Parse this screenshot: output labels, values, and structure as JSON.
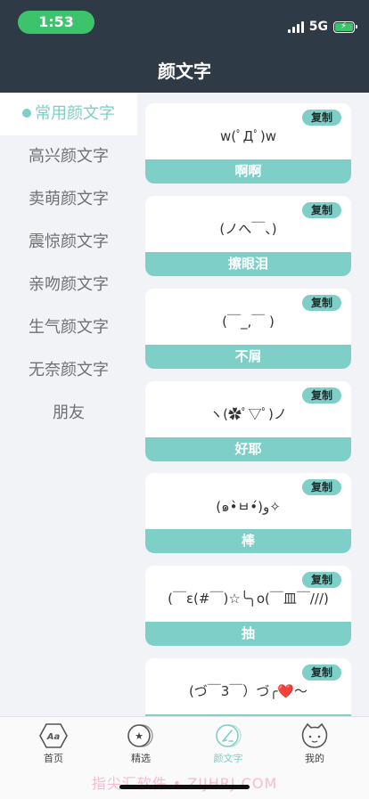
{
  "status": {
    "time": "1:53",
    "network": "5G"
  },
  "header": {
    "title": "颜文字"
  },
  "sidebar": {
    "items": [
      {
        "label": "常用颜文字",
        "active": true
      },
      {
        "label": "高兴颜文字"
      },
      {
        "label": "卖萌颜文字"
      },
      {
        "label": "震惊颜文字"
      },
      {
        "label": "亲吻颜文字"
      },
      {
        "label": "生气颜文字"
      },
      {
        "label": "无奈颜文字"
      },
      {
        "label": "朋友"
      }
    ]
  },
  "cards": [
    {
      "kaomoji": "w(ﾟДﾟ)w",
      "label": "啊啊",
      "copy_label": "复制"
    },
    {
      "kaomoji": "(ノへ￣、)",
      "label": "擦眼泪",
      "copy_label": "复制"
    },
    {
      "kaomoji": "(￣_,￣ )",
      "label": "不屑",
      "copy_label": "复制"
    },
    {
      "kaomoji": "ヽ(✿ﾟ▽ﾟ)ノ",
      "label": "好耶",
      "copy_label": "复制"
    },
    {
      "kaomoji": "(๑•̀ㅂ•́)و✧",
      "label": "棒",
      "copy_label": "复制"
    },
    {
      "kaomoji": "(￣ε(#￣)☆╰╮o(￣皿￣///)",
      "label": "抽",
      "copy_label": "复制"
    },
    {
      "kaomoji": "(づ￣3￣）づ╭❤️～",
      "label": "",
      "copy_label": "复制"
    }
  ],
  "tabbar": {
    "items": [
      {
        "label": "首页",
        "icon": "aa-hexagon-icon",
        "icon_text": "Aa"
      },
      {
        "label": "精选",
        "icon": "star-circle-icon",
        "icon_text": "★"
      },
      {
        "label": "颜文字",
        "icon": "pen-circle-icon",
        "active": true
      },
      {
        "label": "我的",
        "icon": "cat-face-icon"
      }
    ]
  },
  "watermark": "指尖汇软件 • ZIJHRJ.COM",
  "colors": {
    "accent": "#7ecfc8",
    "header": "#2f3a47",
    "status_green": "#3cc36b"
  }
}
